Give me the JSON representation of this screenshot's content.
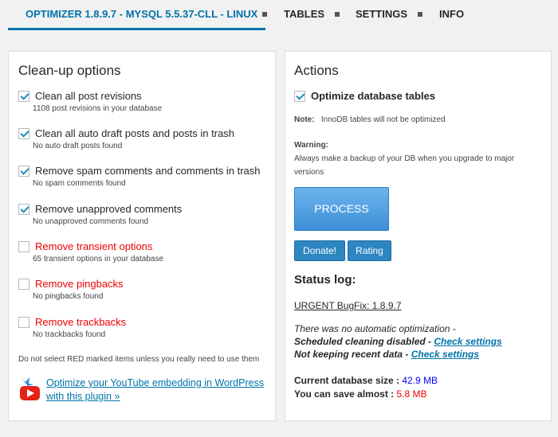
{
  "nav": {
    "tabs": [
      {
        "label": "Optimizer 1.8.9.7 - MySQL 5.5.37-cll - Linux"
      },
      {
        "label": "Tables"
      },
      {
        "label": "Settings"
      },
      {
        "label": "Info"
      }
    ]
  },
  "cleanup": {
    "title": "Clean-up options",
    "options": [
      {
        "label": "Clean all post revisions",
        "desc": "1108 post revisions in your database",
        "checked": true,
        "red": false
      },
      {
        "label": "Clean all auto draft posts and posts in trash",
        "desc": "No auto draft posts found",
        "checked": true,
        "red": false
      },
      {
        "label": "Remove spam comments and comments in trash",
        "desc": "No spam comments found",
        "checked": true,
        "red": false
      },
      {
        "label": "Remove unapproved comments",
        "desc": "No unapproved comments found",
        "checked": true,
        "red": false
      },
      {
        "label": "Remove transient options",
        "desc": "65 transient options in your database",
        "checked": false,
        "red": true
      },
      {
        "label": "Remove pingbacks",
        "desc": "No pingbacks found",
        "checked": false,
        "red": true
      },
      {
        "label": "Remove trackbacks",
        "desc": "No trackbacks found",
        "checked": false,
        "red": true
      }
    ],
    "warning": "Do not select RED marked items unless you really need to use them",
    "youtube_link": "Optimize your YouTube embedding in WordPress with this plugin »"
  },
  "actions": {
    "title": "Actions",
    "optimize_label": "Optimize database tables",
    "note_label": "Note:",
    "note_text": "InnoDB tables will not be optimized",
    "warning_label": "Warning:",
    "warning_text": "Always make a backup of your DB when you upgrade to major versions",
    "process_label": "Process",
    "donate_label": "Donate!",
    "rating_label": "Rating"
  },
  "status": {
    "title": "Status log:",
    "urgent_link": "URGENT BugFix: 1.8.9.7",
    "no_auto": "There was no automatic optimization -",
    "sched_text": "Scheduled cleaning disabled - ",
    "check_settings": "Check settings",
    "recent_text": "Not keeping recent data - ",
    "db_size_label": "Current database size : ",
    "db_size_value": "42.9 MB",
    "save_label": "You can save almost : ",
    "save_value": "5.8 MB"
  },
  "colors": {
    "accent": "#0073aa",
    "red": "#ee0000",
    "size_blue": "#0000ff"
  }
}
